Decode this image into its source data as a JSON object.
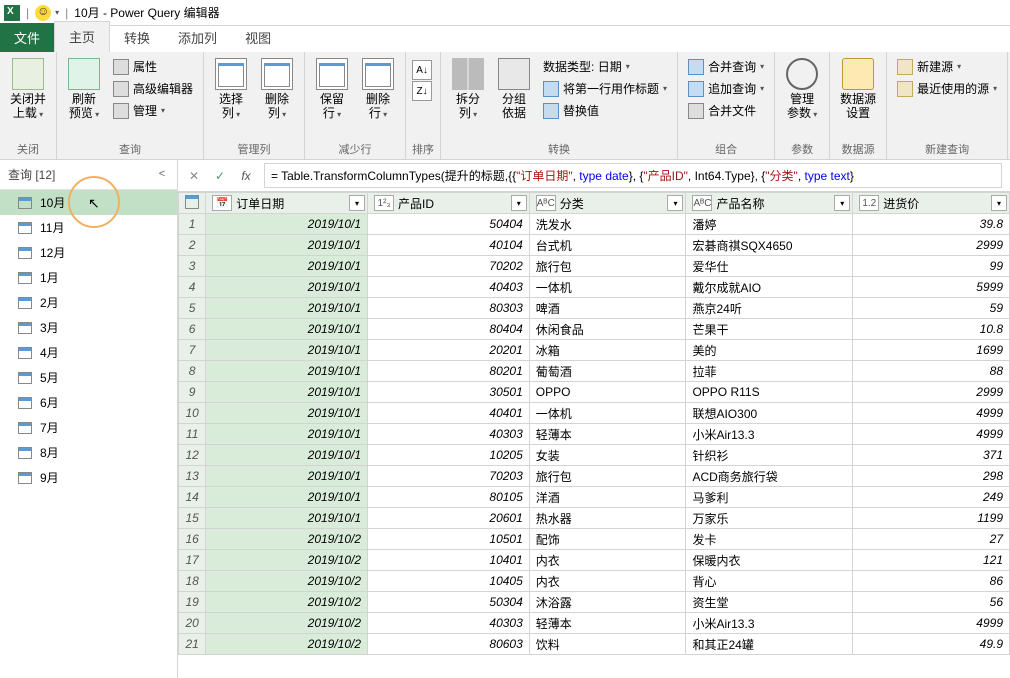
{
  "title": "10月 - Power Query 编辑器",
  "tabs": {
    "file": "文件",
    "home": "主页",
    "transform": "转换",
    "addcol": "添加列",
    "view": "视图"
  },
  "ribbon": {
    "close": {
      "btn": "关闭并\n上载",
      "group": "关闭"
    },
    "query": {
      "refresh": "刷新\n预览",
      "props": "属性",
      "adv": "高级编辑器",
      "manage": "管理",
      "group": "查询"
    },
    "cols": {
      "choose": "选择\n列",
      "remove": "删除\n列",
      "group": "管理列"
    },
    "rows": {
      "keep": "保留\n行",
      "remove": "删除\n行",
      "group": "减少行"
    },
    "sort": {
      "group": "排序"
    },
    "split": {
      "split": "拆分\n列",
      "groupby": "分组\n依据",
      "type": "数据类型: 日期",
      "header": "将第一行用作标题",
      "replace": "替换值",
      "group": "转换"
    },
    "combine": {
      "merge": "合并查询",
      "append": "追加查询",
      "files": "合并文件",
      "group": "组合"
    },
    "params": {
      "btn": "管理\n参数",
      "group": "参数"
    },
    "ds": {
      "btn": "数据源\n设置",
      "group": "数据源"
    },
    "new": {
      "new": "新建源",
      "recent": "最近使用的源",
      "group": "新建查询"
    }
  },
  "queries": {
    "header": "查询 [12]",
    "items": [
      "10月",
      "11月",
      "12月",
      "1月",
      "2月",
      "3月",
      "4月",
      "5月",
      "6月",
      "7月",
      "8月",
      "9月"
    ]
  },
  "formula_parts": {
    "p0": "= Table.TransformColumnTypes(提升的标题,{{",
    "p1": "\"订单日期\"",
    "p2": ", ",
    "p3": "type",
    "p4": " ",
    "p5": "date",
    "p6": "}, {",
    "p7": "\"产品ID\"",
    "p8": ",  Int64.Type}, {",
    "p9": "\"分类\"",
    "p10": ", ",
    "p11": "type",
    "p12": " ",
    "p13": "text",
    "p14": "}"
  },
  "columns": [
    {
      "name": "订单日期",
      "type": "date",
      "icon": "📅"
    },
    {
      "name": "产品ID",
      "type": "int",
      "icon": "1²₃"
    },
    {
      "name": "分类",
      "type": "text",
      "icon": "AᴮC"
    },
    {
      "name": "产品名称",
      "type": "text",
      "icon": "AᴮC"
    },
    {
      "name": "进货价",
      "type": "dec",
      "icon": "1.2"
    }
  ],
  "rows": [
    {
      "n": 1,
      "d": "2019/10/1",
      "id": 50404,
      "cat": "洗发水",
      "name": "潘婷",
      "price": "39.8"
    },
    {
      "n": 2,
      "d": "2019/10/1",
      "id": 40104,
      "cat": "台式机",
      "name": "宏碁商祺SQX4650",
      "price": "2999"
    },
    {
      "n": 3,
      "d": "2019/10/1",
      "id": 70202,
      "cat": "旅行包",
      "name": "爱华仕",
      "price": "99"
    },
    {
      "n": 4,
      "d": "2019/10/1",
      "id": 40403,
      "cat": "一体机",
      "name": "戴尔成就AIO",
      "price": "5999"
    },
    {
      "n": 5,
      "d": "2019/10/1",
      "id": 80303,
      "cat": "啤酒",
      "name": "燕京24听",
      "price": "59"
    },
    {
      "n": 6,
      "d": "2019/10/1",
      "id": 80404,
      "cat": "休闲食品",
      "name": "芒果干",
      "price": "10.8"
    },
    {
      "n": 7,
      "d": "2019/10/1",
      "id": 20201,
      "cat": "冰箱",
      "name": "美的",
      "price": "1699"
    },
    {
      "n": 8,
      "d": "2019/10/1",
      "id": 80201,
      "cat": "葡萄酒",
      "name": "拉菲",
      "price": "88"
    },
    {
      "n": 9,
      "d": "2019/10/1",
      "id": 30501,
      "cat": "OPPO",
      "name": "OPPO R11S",
      "price": "2999"
    },
    {
      "n": 10,
      "d": "2019/10/1",
      "id": 40401,
      "cat": "一体机",
      "name": "联想AIO300",
      "price": "4999"
    },
    {
      "n": 11,
      "d": "2019/10/1",
      "id": 40303,
      "cat": "轻薄本",
      "name": "小米Air13.3",
      "price": "4999"
    },
    {
      "n": 12,
      "d": "2019/10/1",
      "id": 10205,
      "cat": "女装",
      "name": "针织衫",
      "price": "371"
    },
    {
      "n": 13,
      "d": "2019/10/1",
      "id": 70203,
      "cat": "旅行包",
      "name": "ACD商务旅行袋",
      "price": "298"
    },
    {
      "n": 14,
      "d": "2019/10/1",
      "id": 80105,
      "cat": "洋酒",
      "name": "马爹利",
      "price": "249"
    },
    {
      "n": 15,
      "d": "2019/10/1",
      "id": 20601,
      "cat": "热水器",
      "name": "万家乐",
      "price": "1199"
    },
    {
      "n": 16,
      "d": "2019/10/2",
      "id": 10501,
      "cat": "配饰",
      "name": "发卡",
      "price": "27"
    },
    {
      "n": 17,
      "d": "2019/10/2",
      "id": 10401,
      "cat": "内衣",
      "name": "保暖内衣",
      "price": "121"
    },
    {
      "n": 18,
      "d": "2019/10/2",
      "id": 10405,
      "cat": "内衣",
      "name": "背心",
      "price": "86"
    },
    {
      "n": 19,
      "d": "2019/10/2",
      "id": 50304,
      "cat": "沐浴露",
      "name": "资生堂",
      "price": "56"
    },
    {
      "n": 20,
      "d": "2019/10/2",
      "id": 40303,
      "cat": "轻薄本",
      "name": "小米Air13.3",
      "price": "4999"
    },
    {
      "n": 21,
      "d": "2019/10/2",
      "id": 80603,
      "cat": "饮料",
      "name": "和其正24罐",
      "price": "49.9"
    }
  ]
}
